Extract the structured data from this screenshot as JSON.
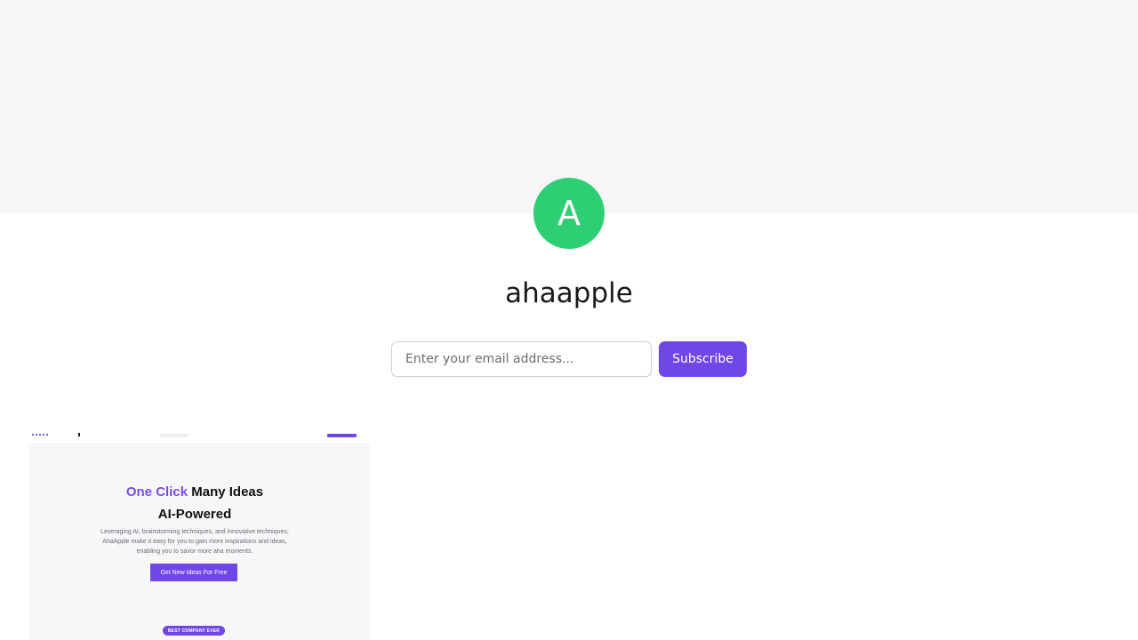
{
  "profile": {
    "avatar_letter": "A",
    "avatar_color": "#2ecf74",
    "name": "ahaapple"
  },
  "subscribe": {
    "placeholder": "Enter your email address...",
    "button_label": "Subscribe",
    "accent": "#7046e6"
  },
  "post_preview": {
    "headline_accent": "One Click",
    "headline_rest": "Many Ideas",
    "headline_line2": "AI-Powered",
    "description": "Leveraging AI, brainstorming techniques, and innovative techniques, AhaApple make it easy for you to gain more inspirations and ideas, enabling you to savor more aha moments.",
    "cta_label": "Get New Ideas For Free",
    "badge": "BEST COMPANY EVER"
  }
}
